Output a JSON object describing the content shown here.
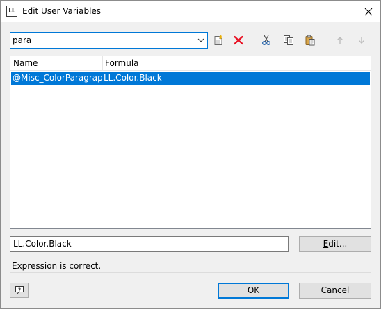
{
  "window": {
    "title": "Edit User Variables",
    "app_icon_text": "LL"
  },
  "search": {
    "value": "para"
  },
  "toolbar": {
    "buttons": [
      {
        "name": "new-variable-button",
        "icon": "new-document-icon"
      },
      {
        "name": "delete-button",
        "icon": "red-x-delete-icon"
      },
      {
        "name": "cut-button",
        "icon": "scissors-icon"
      },
      {
        "name": "copy-button",
        "icon": "copy-icon"
      },
      {
        "name": "paste-button",
        "icon": "clipboard-paste-icon"
      },
      {
        "name": "move-up-button",
        "icon": "arrow-up-icon"
      },
      {
        "name": "move-down-button",
        "icon": "arrow-down-icon"
      }
    ]
  },
  "list": {
    "columns": [
      "Name",
      "Formula"
    ],
    "rows": [
      {
        "name": "@Misc_ColorParagraph",
        "formula": "LL.Color.Black",
        "selected": true
      }
    ]
  },
  "formula_field": {
    "value": "LL.Color.Black"
  },
  "buttons": {
    "edit_label": "Edit...",
    "ok_label": "OK",
    "cancel_label": "Cancel"
  },
  "status": {
    "message": "Expression is correct."
  },
  "colors": {
    "selection": "#0078d7",
    "delete_red": "#e81123",
    "dialog_bg": "#f0f0f0"
  }
}
